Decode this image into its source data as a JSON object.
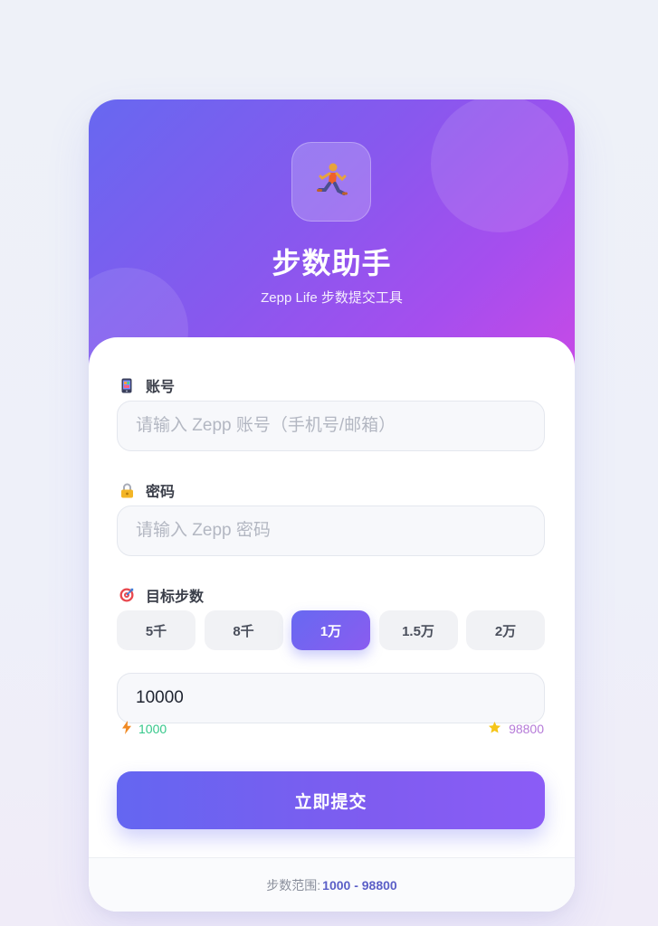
{
  "header": {
    "app_icon": "running-person-icon",
    "title": "步数助手",
    "subtitle": "Zepp Life 步数提交工具"
  },
  "form": {
    "account": {
      "icon": "phone-icon",
      "label": "账号",
      "placeholder": "请输入 Zepp 账号（手机号/邮箱）",
      "value": ""
    },
    "password": {
      "icon": "lock-icon",
      "label": "密码",
      "placeholder": "请输入 Zepp 密码",
      "value": ""
    },
    "steps": {
      "icon": "target-icon",
      "label": "目标步数",
      "presets": [
        "5千",
        "8千",
        "1万",
        "1.5万",
        "2万"
      ],
      "selected_preset": "1万",
      "value": "10000",
      "min_icon": "lightning-icon",
      "min": "1000",
      "max_icon": "star-icon",
      "max": "98800"
    },
    "submit_label": "立即提交"
  },
  "footer": {
    "range_label": "步数范围:",
    "range_value": "1000 - 98800"
  },
  "colors": {
    "accent": "#6466f1",
    "accent_secondary": "#8b5cf6",
    "hero_end": "#c74ae6",
    "min_color": "#34c78a",
    "max_color": "#b57ad8"
  }
}
